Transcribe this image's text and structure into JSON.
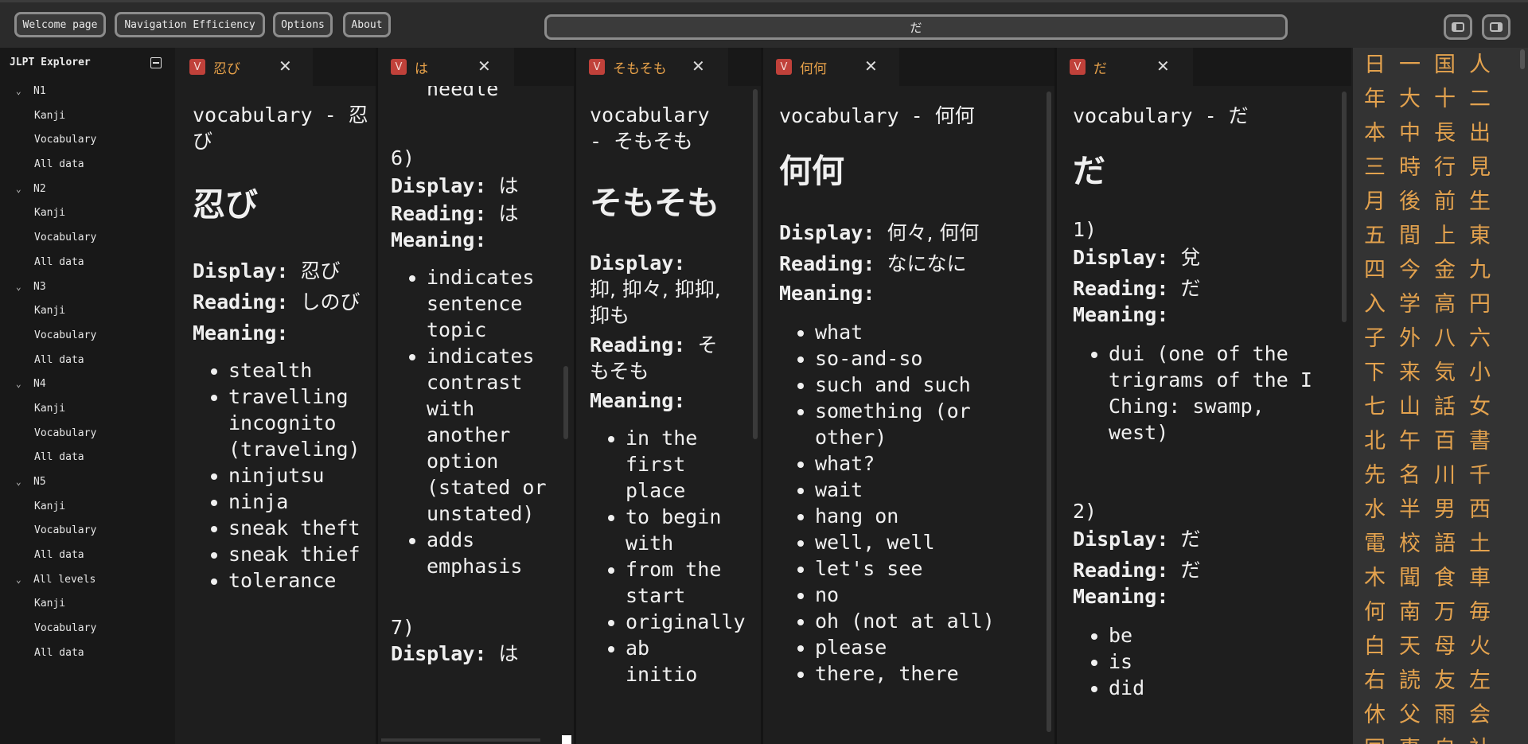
{
  "toolbar": {
    "welcome": "Welcome page",
    "nav_eff": "Navigation Efficiency",
    "options": "Options",
    "about": "About",
    "search_value": "だ"
  },
  "sidebar": {
    "title": "JLPT Explorer",
    "groups": [
      {
        "label": "N1",
        "items": [
          "Kanji",
          "Vocabulary",
          "All data"
        ]
      },
      {
        "label": "N2",
        "items": [
          "Kanji",
          "Vocabulary",
          "All data"
        ]
      },
      {
        "label": "N3",
        "items": [
          "Kanji",
          "Vocabulary",
          "All data"
        ]
      },
      {
        "label": "N4",
        "items": [
          "Kanji",
          "Vocabulary",
          "All data"
        ]
      },
      {
        "label": "N5",
        "items": [
          "Kanji",
          "Vocabulary",
          "All data"
        ]
      },
      {
        "label": "All levels",
        "items": [
          "Kanji",
          "Vocabulary",
          "All data"
        ]
      }
    ]
  },
  "labels": {
    "display": "Display:",
    "reading": "Reading:",
    "meaning": "Meaning:",
    "badge": "V"
  },
  "panes": {
    "p1": {
      "tab": "忍び",
      "title": "vocabulary - 忍び",
      "word": "忍び",
      "display": "忍び",
      "reading": "しのび",
      "meanings": [
        "stealth",
        "travelling incognito (traveling)",
        "ninjutsu",
        "ninja",
        "sneak theft",
        "sneak thief",
        "tolerance"
      ]
    },
    "p2": {
      "tab": "は",
      "top_fragment": "needle",
      "n6": "6)",
      "display": "は",
      "reading": "は",
      "meanings": [
        "indicates sentence topic",
        "indicates contrast with another option (stated or unstated)",
        "adds emphasis"
      ],
      "n7": "7)",
      "display7": "は"
    },
    "p3": {
      "tab": "そもそも",
      "title": "vocabulary - そもそも",
      "word": "そもそも",
      "display": "抑, 抑々, 抑抑, 抑も",
      "reading": "そもそも",
      "meanings": [
        "in the first place",
        "to begin with",
        "from the start",
        "originally",
        "ab initio"
      ]
    },
    "p4": {
      "tab": "何何",
      "title": "vocabulary - 何何",
      "word": "何何",
      "display": "何々, 何何",
      "reading": "なになに",
      "meanings": [
        "what",
        "so-and-so",
        "such and such",
        "something (or other)",
        "what?",
        "wait",
        "hang on",
        "well, well",
        "let's see",
        "no",
        "oh (not at all)",
        "please",
        "there, there"
      ]
    },
    "p5": {
      "tab": "だ",
      "title": "vocabulary - だ",
      "word": "だ",
      "n1": "1)",
      "display1": "兌",
      "reading1": "だ",
      "meanings1": [
        "dui (one of the trigrams of the I Ching: swamp, west)"
      ],
      "n2": "2)",
      "display2": "だ",
      "reading2": "だ",
      "meanings2": [
        "be",
        "is",
        "did"
      ]
    }
  },
  "kanji": [
    "日",
    "一",
    "国",
    "人",
    "年",
    "大",
    "十",
    "二",
    "本",
    "中",
    "長",
    "出",
    "三",
    "時",
    "行",
    "見",
    "月",
    "後",
    "前",
    "生",
    "五",
    "間",
    "上",
    "東",
    "四",
    "今",
    "金",
    "九",
    "入",
    "学",
    "高",
    "円",
    "子",
    "外",
    "八",
    "六",
    "下",
    "来",
    "気",
    "小",
    "七",
    "山",
    "話",
    "女",
    "北",
    "午",
    "百",
    "書",
    "先",
    "名",
    "川",
    "千",
    "水",
    "半",
    "男",
    "西",
    "電",
    "校",
    "語",
    "土",
    "木",
    "聞",
    "食",
    "車",
    "何",
    "南",
    "万",
    "毎",
    "白",
    "天",
    "母",
    "火",
    "右",
    "読",
    "友",
    "左",
    "休",
    "父",
    "雨",
    "会",
    "同",
    "事",
    "自",
    "社"
  ]
}
